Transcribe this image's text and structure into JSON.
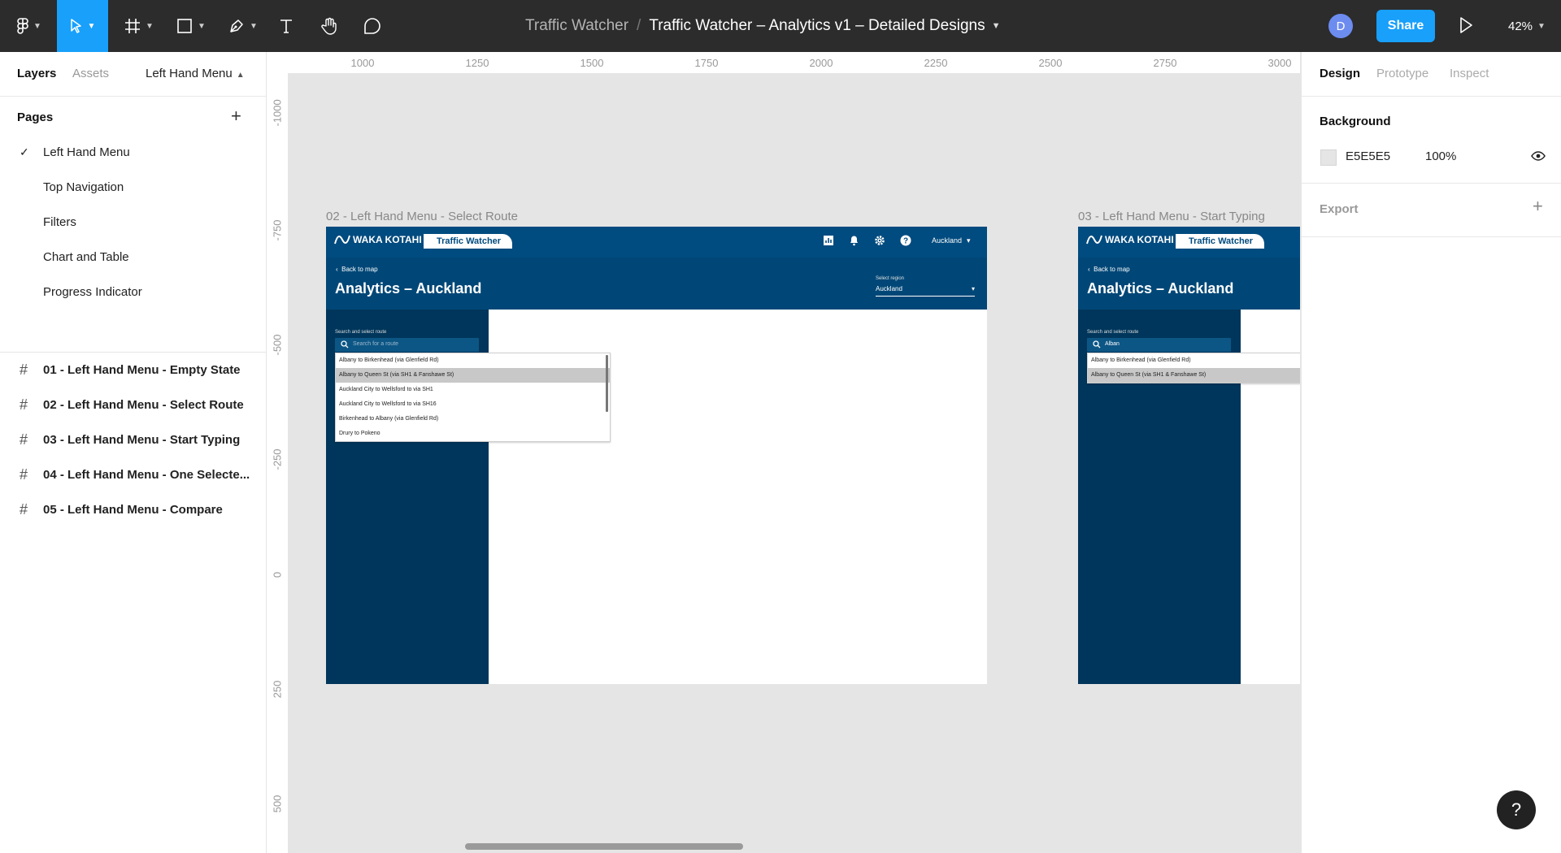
{
  "toolbar": {
    "project": "Traffic Watcher",
    "separator": "/",
    "file": "Traffic Watcher – Analytics v1 – Detailed Designs",
    "avatar_initial": "D",
    "share_label": "Share",
    "zoom": "42%",
    "accent": "#18a0fb"
  },
  "left_panel": {
    "tabs": [
      "Layers",
      "Assets"
    ],
    "current_page": "Left Hand Menu",
    "pages_title": "Pages",
    "pages": [
      "Left Hand Menu",
      "Top Navigation",
      "Filters",
      "Chart and Table",
      "Progress Indicator"
    ],
    "frames": [
      "01 - Left Hand Menu - Empty State",
      "02 - Left Hand Menu - Select Route",
      "03 - Left Hand Menu - Start Typing",
      "04 - Left Hand Menu - One Selecte...",
      "05 - Left Hand Menu - Compare"
    ]
  },
  "canvas": {
    "ruler_top": [
      "1000",
      "1250",
      "1500",
      "1750",
      "2000",
      "2250",
      "2500",
      "2750",
      "3000"
    ],
    "ruler_left": [
      "-1000",
      "-750",
      "-500",
      "-250",
      "0",
      "250",
      "500"
    ],
    "frame_a_label": "02 - Left Hand Menu - Select Route",
    "frame_b_label": "03 - Left Hand Menu - Start Typing",
    "mock": {
      "brand": "WAKA KOTAHI",
      "brand_tag": "Traffic Watcher",
      "region_top": "Auckland",
      "back": "Back to map",
      "title": "Analytics – Auckland",
      "select_region_label": "Select region",
      "select_region_value": "Auckland",
      "search_label": "Search and select route",
      "search_placeholder": "Search for a route",
      "search_typed": "Alban",
      "routes_a": [
        "Albany to Birkenhead (via Glenfield Rd)",
        "Albany to Queen St (via SH1 & Fanshawe St)",
        "Auckland City to Wellsford to via SH1",
        "Auckland City to Wellsford to via SH16",
        "Birkenhead to Albany (via Glenfield Rd)",
        "Drury to Pokeno"
      ],
      "routes_b": [
        "Albany to Birkenhead (via Glenfield Rd)",
        "Albany to Queen St (via SH1 & Fanshawe St)"
      ],
      "colors": {
        "header": "#004b7f",
        "sidebar": "#00365b"
      }
    }
  },
  "right_panel": {
    "tabs": [
      "Design",
      "Prototype",
      "Inspect"
    ],
    "background_title": "Background",
    "background_hex": "E5E5E5",
    "background_opacity": "100%",
    "export_title": "Export"
  },
  "help_label": "?"
}
